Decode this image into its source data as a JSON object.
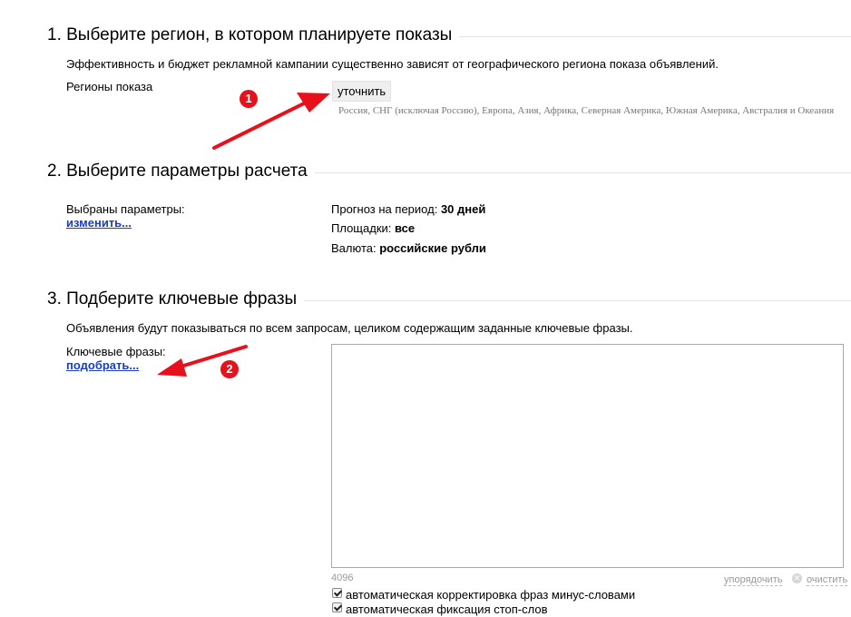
{
  "section1": {
    "title": "1. Выберите регион, в котором планируете показы",
    "description": "Эффективность и бюджет рекламной кампании существенно зависят от географического региона показа объявлений.",
    "regions_label": "Регионы показа",
    "refine_button": "уточнить",
    "regions_list": "Россия, СНГ (исключая Россию), Европа, Азия, Африка, Северная Америка, Южная Америка, Австралия и Океания"
  },
  "section2": {
    "title": "2. Выберите параметры расчета",
    "selected_label": "Выбраны параметры:",
    "change_link": "изменить...",
    "params": [
      {
        "label": "Прогноз на период:",
        "value": "30 дней"
      },
      {
        "label": "Площадки:",
        "value": "все"
      },
      {
        "label": "Валюта:",
        "value": "российские рубли"
      }
    ]
  },
  "section3": {
    "title": "3. Подберите ключевые фразы",
    "description": "Объявления будут показываться по всем запросам, целиком содержащим заданные ключевые фразы.",
    "keywords_label": "Ключевые фразы:",
    "pick_link": "подобрать...",
    "keywords_value": "",
    "char_limit": "4096",
    "sort_link": "упорядочить",
    "clear_link": "очистить",
    "options": [
      {
        "label": "автоматическая корректировка фраз минус-словами",
        "checked": true
      },
      {
        "label": "автоматическая фиксация стоп-слов",
        "checked": true
      }
    ]
  },
  "annotations": {
    "marker1": "1",
    "marker2": "2",
    "color": "#e8101a"
  }
}
